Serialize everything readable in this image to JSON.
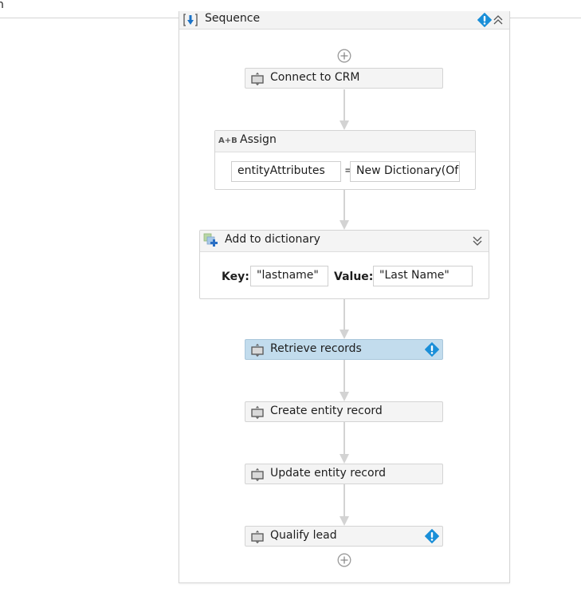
{
  "topbar": {
    "text": "n"
  },
  "sequence": {
    "title": "Sequence",
    "has_warning": true
  },
  "activities": {
    "connect": {
      "label": "Connect to CRM"
    },
    "assign": {
      "label": "Assign",
      "icon_text": "A+B",
      "to": "entityAttributes",
      "operator": "=",
      "value": "New Dictionary(Of"
    },
    "add_dict": {
      "label": "Add to dictionary",
      "key_label": "Key:",
      "key_value": "\"lastname\"",
      "value_label": "Value:",
      "value_value": "\"Last Name\""
    },
    "retrieve": {
      "label": "Retrieve records",
      "selected": true,
      "has_warning": true
    },
    "create": {
      "label": "Create entity record"
    },
    "update": {
      "label": "Update entity record"
    },
    "qualify": {
      "label": "Qualify lead",
      "has_warning": true
    }
  },
  "colors": {
    "warning_blue": "#1a8fd8",
    "selected_bg": "#c2dced",
    "connector": "#d3d3d3"
  }
}
